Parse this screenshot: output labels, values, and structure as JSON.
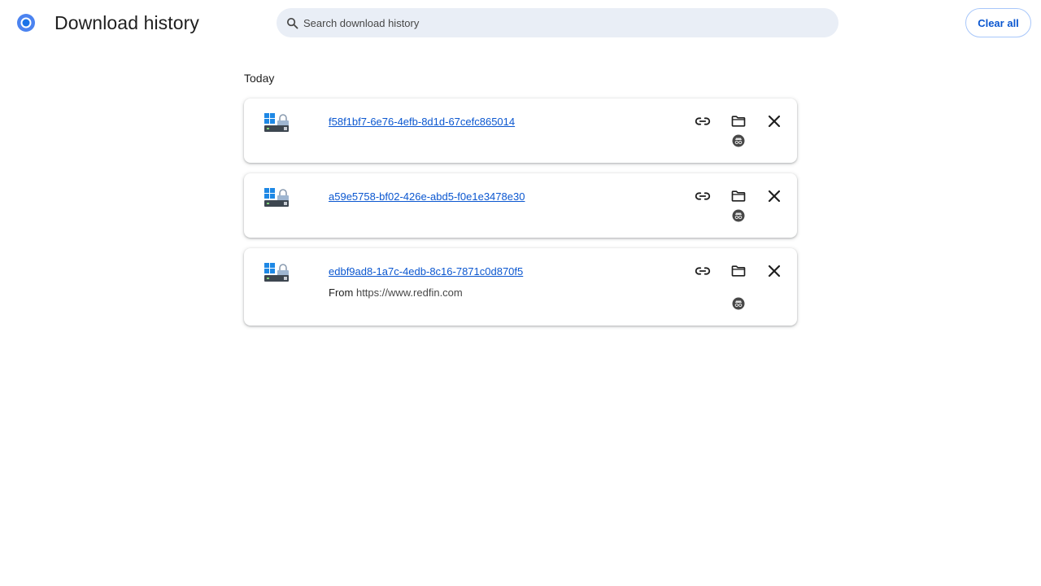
{
  "header": {
    "title": "Download history",
    "search_placeholder": "Search download history",
    "clear_all_label": "Clear all"
  },
  "colors": {
    "accent": "#0b57d0",
    "search_bg": "#e9eef6",
    "button_border": "#a8c7fa"
  },
  "icons": {
    "logo": "chrome-logo",
    "search": "search-icon",
    "file": "windows-installer-icon",
    "copy": "link-icon",
    "folder": "folder-icon",
    "remove": "close-icon",
    "status": "incognito-icon"
  },
  "sections": [
    {
      "label": "Today",
      "items": [
        {
          "filename": "f58f1bf7-6e76-4efb-8d1d-67cefc865014"
        },
        {
          "filename": "a59e5758-bf02-426e-abd5-f0e1e3478e30"
        },
        {
          "filename": "edbf9ad8-1a7c-4edb-8c16-7871c0d870f5",
          "from_label": "From",
          "from_url": "https://www.redfin.com"
        }
      ]
    }
  ]
}
